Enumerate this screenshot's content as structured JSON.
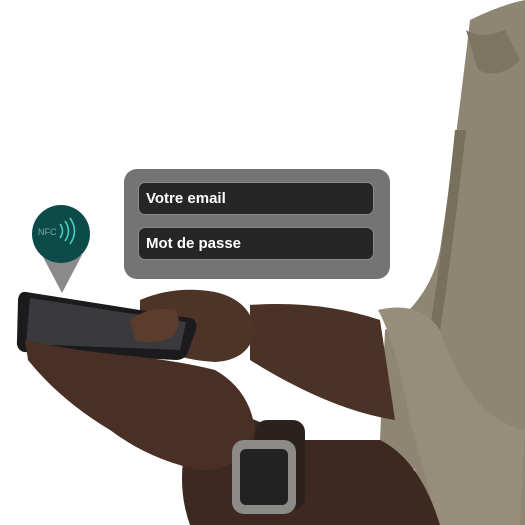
{
  "login": {
    "email_placeholder": "Votre email",
    "password_placeholder": "Mot de passe"
  },
  "nfc_badge": {
    "label": "NFC",
    "icon": "nfc-icon"
  },
  "colors": {
    "panel": "#747474",
    "field": "#262626",
    "field_text": "#ffffff",
    "nfc_circle": "#0d4b4a",
    "nfc_waves": "#3fd2c2",
    "pin_tail": "#8a8a8a"
  }
}
